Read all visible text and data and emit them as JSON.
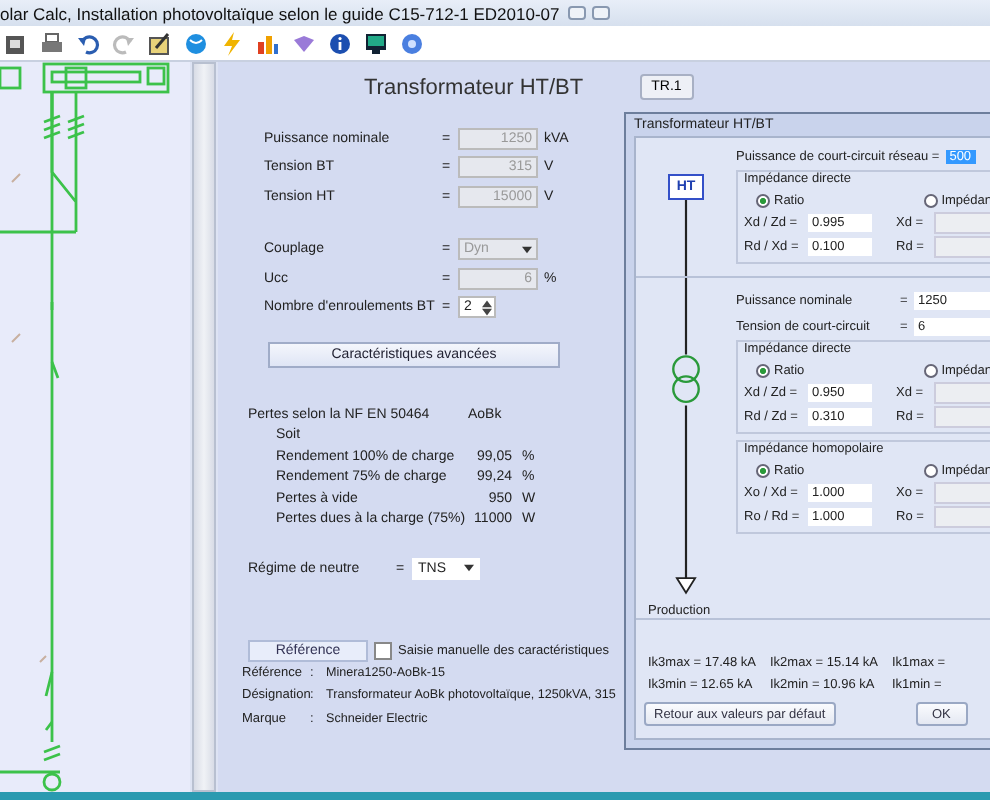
{
  "window": {
    "title": "olar Calc, Installation photovoltaïque selon le guide C15-712-1 ED2010-07"
  },
  "main_panel": {
    "title": "Transformateur HT/BT",
    "tab_button": "TR.1",
    "fields": [
      {
        "kind": "input",
        "label": "Puissance nominale",
        "equals": "=",
        "value": "1250",
        "unit": "kVA",
        "disabled": true
      },
      {
        "kind": "input",
        "label": "Tension BT",
        "equals": "=",
        "value": "315",
        "unit": "V",
        "disabled": true
      },
      {
        "kind": "input",
        "label": "Tension HT",
        "equals": "=",
        "value": "15000",
        "unit": "V",
        "disabled": true
      },
      {
        "kind": "select",
        "label": "Couplage",
        "equals": "=",
        "value": "Dyn",
        "disabled": true
      },
      {
        "kind": "input",
        "label": "Ucc",
        "equals": "=",
        "value": "6",
        "unit": "%",
        "disabled": true
      },
      {
        "kind": "spin",
        "label": "Nombre d'enroulements BT",
        "equals": "=",
        "value": "2",
        "disabled": false
      }
    ],
    "advanced_button": "Caractéristiques avancées",
    "losses": {
      "label": "Pertes selon la NF EN 50464",
      "value": "AoBk",
      "sub_label": "Soit",
      "rows": [
        {
          "label": "Rendement 100% de charge",
          "value": "99,05",
          "unit": "%"
        },
        {
          "label": "Rendement 75% de charge",
          "value": "99,24",
          "unit": "%"
        },
        {
          "label": "Pertes à vide",
          "value": "950",
          "unit": "W"
        },
        {
          "label": "Pertes dues à la charge (75%)",
          "value": "11000",
          "unit": "W"
        }
      ]
    },
    "neutral": {
      "label": "Régime de neutre",
      "equals": "=",
      "value": "TNS"
    },
    "reference_button": "Référence",
    "manual_checkbox": {
      "label": "Saisie manuelle des caractéristiques",
      "checked": false
    },
    "info": [
      {
        "label": "Référence",
        "colon": ":",
        "value": "Minera1250-AoBk-15"
      },
      {
        "label": "Désignation",
        "colon": ":",
        "value": "Transformateur AoBk photovoltaïque, 1250kVA, 315"
      },
      {
        "label": "Marque",
        "colon": ":",
        "value": "Schneider Electric"
      }
    ]
  },
  "dialog": {
    "title": "Transformateur HT/BT",
    "schematic_top": "HT",
    "schematic_bottom": "Production",
    "network": {
      "label": "Puissance de court-circuit réseau =",
      "value": "500"
    },
    "groups_top": [
      {
        "title": "Impédance directe",
        "options": [
          {
            "label": "Ratio",
            "selected": true
          },
          {
            "label": "Impédan",
            "selected": false
          }
        ],
        "rows": [
          {
            "label": "Xd / Zd =",
            "value": "0.995",
            "abs_label": "Xd ="
          },
          {
            "label": "Rd / Xd =",
            "value": "0.100",
            "abs_label": "Rd ="
          }
        ]
      }
    ],
    "fields": [
      {
        "label": "Puissance nominale",
        "equals": "=",
        "value": "1250"
      },
      {
        "label": "Tension de court-circuit",
        "equals": "=",
        "value": "6"
      }
    ],
    "groups_bottom": [
      {
        "title": "Impédance directe",
        "options": [
          {
            "label": "Ratio",
            "selected": true
          },
          {
            "label": "Impédan",
            "selected": false
          }
        ],
        "rows": [
          {
            "label": "Xd / Zd =",
            "value": "0.950",
            "abs_label": "Xd ="
          },
          {
            "label": "Rd / Zd =",
            "value": "0.310",
            "abs_label": "Rd ="
          }
        ]
      },
      {
        "title": "Impédance homopolaire",
        "options": [
          {
            "label": "Ratio",
            "selected": true
          },
          {
            "label": "Impédan",
            "selected": false
          }
        ],
        "rows": [
          {
            "label": "Xo / Xd =",
            "value": "1.000",
            "abs_label": "Xo ="
          },
          {
            "label": "Ro / Rd =",
            "value": "1.000",
            "abs_label": "Ro ="
          }
        ]
      }
    ],
    "results": [
      [
        "Ik3max = 17.48 kA",
        "Ik2max = 15.14 kA",
        "Ik1max ="
      ],
      [
        "Ik3min = 12.65 kA",
        "Ik2min = 10.96 kA",
        "Ik1min ="
      ]
    ],
    "default_button": "Retour aux valeurs par défaut",
    "ok_button": "OK"
  }
}
